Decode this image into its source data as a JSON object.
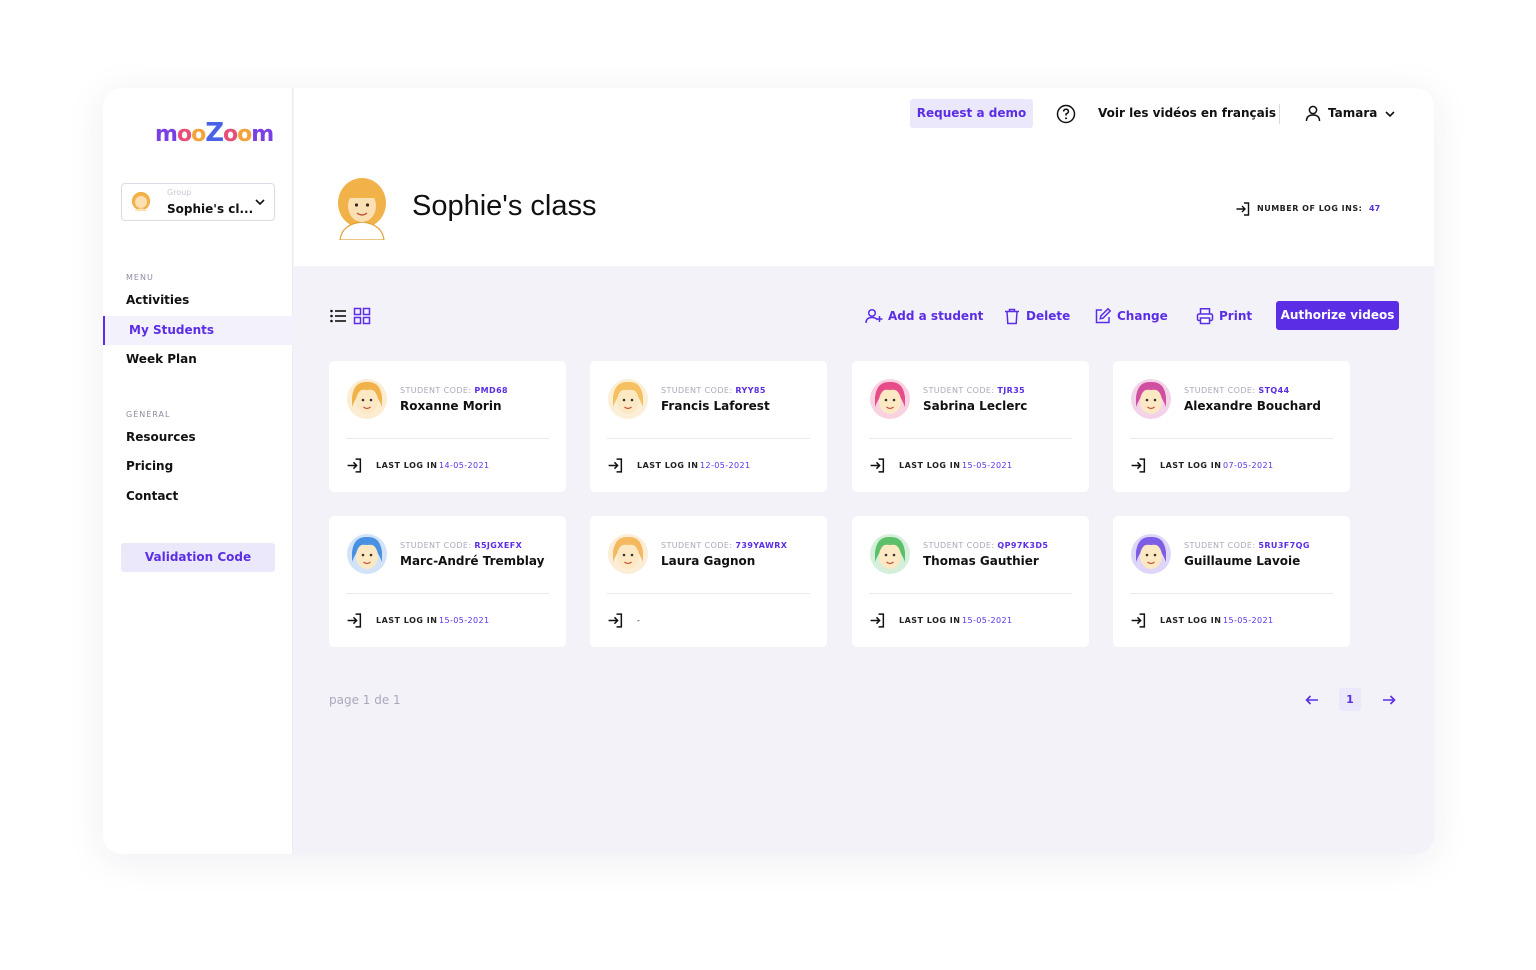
{
  "brand": {
    "logo_letters": [
      "m",
      "o",
      "o",
      "Z",
      "o",
      "o",
      "m"
    ],
    "logo_colors": [
      "#7b3fe4",
      "#e94e77",
      "#f2a33a",
      "#4a63e6",
      "#e94e77",
      "#f2a33a",
      "#7b3fe4"
    ]
  },
  "group_select": {
    "label": "Group",
    "value": "Sophie's cl..."
  },
  "sidebar": {
    "menu_label": "MENU",
    "menu_items": [
      {
        "label": "Activities",
        "active": false
      },
      {
        "label": "My Students",
        "active": true
      },
      {
        "label": "Week Plan",
        "active": false
      }
    ],
    "general_label": "GÉNÉRAL",
    "general_items": [
      {
        "label": "Resources"
      },
      {
        "label": "Pricing"
      },
      {
        "label": "Contact"
      }
    ],
    "validation_button": "Validation Code"
  },
  "topbar": {
    "request_demo": "Request a demo",
    "french_videos": "Voir les vidéos en français",
    "user_name": "Tamara"
  },
  "class": {
    "title": "Sophie's class",
    "logins_label": "NUMBER OF LOG INS:",
    "logins_value": "47"
  },
  "toolbar": {
    "add_student": "Add a student",
    "delete": "Delete",
    "change": "Change",
    "print": "Print",
    "authorize": "Authorize videos"
  },
  "card_labels": {
    "code_prefix": "STUDENT CODE:",
    "last_log_prefix": "LAST LOG IN"
  },
  "students": [
    {
      "code": "PMD68",
      "name": "Roxanne Morin",
      "last_log": "14-05-2021",
      "avatar_color": "#f2b24a"
    },
    {
      "code": "RYY85",
      "name": "Francis Laforest",
      "last_log": "12-05-2021",
      "avatar_color": "#f4c060"
    },
    {
      "code": "TJR35",
      "name": "Sabrina Leclerc",
      "last_log": "15-05-2021",
      "avatar_color": "#e84b8a"
    },
    {
      "code": "STQ44",
      "name": "Alexandre Bouchard",
      "last_log": "07-05-2021",
      "avatar_color": "#d14fa0"
    },
    {
      "code": "R5JGXEFX",
      "name": "Marc-André Tremblay",
      "last_log": "15-05-2021",
      "avatar_color": "#4a90e2"
    },
    {
      "code": "739YAWRX",
      "name": "Laura Gagnon",
      "last_log": "-",
      "avatar_color": "#f4b860"
    },
    {
      "code": "QP97K3D5",
      "name": "Thomas Gauthier",
      "last_log": "15-05-2021",
      "avatar_color": "#5cbf6a"
    },
    {
      "code": "5RU3F7QG",
      "name": "Guillaume Lavoie",
      "last_log": "15-05-2021",
      "avatar_color": "#7d5ce6"
    }
  ],
  "pagination": {
    "text": "page 1 de 1",
    "current": "1"
  },
  "colors": {
    "accent": "#5b2ee6",
    "accent_soft": "#ece8fb",
    "background": "#f3f2f8"
  }
}
